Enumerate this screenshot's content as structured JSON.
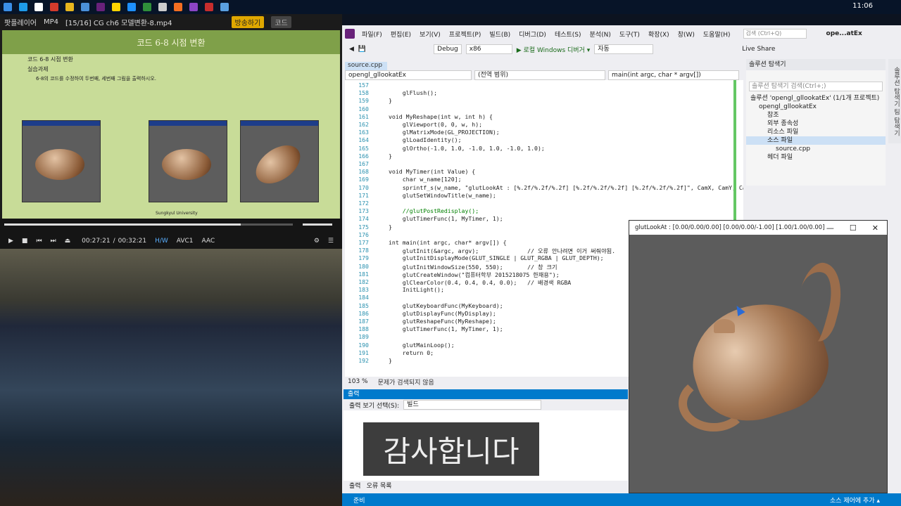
{
  "taskbar": {
    "clock": "11:06"
  },
  "player": {
    "app_name": "팟플레이어",
    "format": "MP4",
    "file_title": "[15/16] CG ch6 모델변환-8.mp4",
    "broadcast_btn": "방송하기",
    "code_btn": "코드",
    "time_current": "00:27:21",
    "time_total": "00:32:21",
    "hw": "H/W",
    "vcodec": "AVC1",
    "acodec": "AAC",
    "progress": 0.82
  },
  "slide": {
    "title": "코드 6-8 시점 변환",
    "bullet1": "코드 6-8 시점 변환",
    "bullet2": "실습과제",
    "bullet3": "6-8의 코드를 수정하여 두번째, 세번째 그림을 출력하시오.",
    "footer": "Sungkyul University"
  },
  "vs": {
    "menu": [
      "파일(F)",
      "편집(E)",
      "보기(V)",
      "프로젝트(P)",
      "빌드(B)",
      "디버그(D)",
      "테스트(S)",
      "분석(N)",
      "도구(T)",
      "확장(X)",
      "창(W)",
      "도움말(H)"
    ],
    "search_placeholder": "검색 (Ctrl+Q)",
    "window_title": "ope...atEx",
    "config": "Debug",
    "platform": "x86",
    "run_label": "▶ 로컬 Windows 디버거 ▾",
    "auto": "자동",
    "live_share": "Live Share",
    "doc_tab": "source.cpp",
    "nav_project": "opengl_gllookatEx",
    "nav_scope": "(전역 범위)",
    "nav_func": "main(int argc, char * argv[])",
    "zoom": "103 %",
    "issues": "문제가 검색되지 않음",
    "output_title": "출력",
    "output_select_label": "출력 보기 선택(S):",
    "output_select_value": "빌드",
    "output_tab1": "출력",
    "output_tab2": "오류 목록",
    "status_ready": "준비",
    "status_source_control": "소스 제어에 추가 ▴",
    "thanks": "감사합니다",
    "solution": {
      "header": "솔루션 탐색기",
      "search": "솔루션 탐색기 검색(Ctrl+;)",
      "side_tab": "솔루션 탐색기 팀 탐색기",
      "nodes": [
        {
          "text": "솔루션 'opengl_gllookatEx' (1/1개 프로젝트)",
          "indent": 0
        },
        {
          "text": "opengl_gllookatEx",
          "indent": 1
        },
        {
          "text": "참조",
          "indent": 2
        },
        {
          "text": "외부 종속성",
          "indent": 2
        },
        {
          "text": "리소스 파일",
          "indent": 2
        },
        {
          "text": "소스 파일",
          "indent": 2
        },
        {
          "text": "source.cpp",
          "indent": 3
        },
        {
          "text": "헤더 파일",
          "indent": 2
        }
      ]
    }
  },
  "code_lines": [
    {
      "n": "157",
      "t": ""
    },
    {
      "n": "158",
      "t": "    glFlush();"
    },
    {
      "n": "159",
      "t": "}"
    },
    {
      "n": "160",
      "t": ""
    },
    {
      "n": "161",
      "t": "void MyReshape(int w, int h) {"
    },
    {
      "n": "162",
      "t": "    glViewport(0, 0, w, h);"
    },
    {
      "n": "163",
      "t": "    glMatrixMode(GL_PROJECTION);"
    },
    {
      "n": "164",
      "t": "    glLoadIdentity();"
    },
    {
      "n": "165",
      "t": "    glOrtho(-1.0, 1.0, -1.0, 1.0, -1.0, 1.0);"
    },
    {
      "n": "166",
      "t": "}"
    },
    {
      "n": "167",
      "t": ""
    },
    {
      "n": "168",
      "t": "void MyTimer(int Value) {"
    },
    {
      "n": "169",
      "t": "    char w_name[120];"
    },
    {
      "n": "170",
      "t": "    sprintf_s(w_name, \"glutLookAt : [%.2f/%.2f/%.2f] [%.2f/%.2f/%.2f] [%.2f/%.2f/%.2f]\", CamX, CamY, CamZ, Vie"
    },
    {
      "n": "171",
      "t": "    glutSetWindowTitle(w_name);"
    },
    {
      "n": "172",
      "t": ""
    },
    {
      "n": "173",
      "t": "    //glutPostRedisplay();"
    },
    {
      "n": "174",
      "t": "    glutTimerFunc(1, MyTimer, 1);"
    },
    {
      "n": "175",
      "t": "}"
    },
    {
      "n": "176",
      "t": ""
    },
    {
      "n": "177",
      "t": "int main(int argc, char* argv[]) {"
    },
    {
      "n": "178",
      "t": "    glutInit(&argc, argv);              // 오류 안나려면 이거 써줘야됨."
    },
    {
      "n": "179",
      "t": "    glutInitDisplayMode(GLUT_SINGLE | GLUT_RGBA | GLUT_DEPTH);"
    },
    {
      "n": "180",
      "t": "    glutInitWindowSize(550, 550);       // 창 크기"
    },
    {
      "n": "181",
      "t": "    glutCreateWindow(\"컴퓨터학부 2015218075 한재용\");"
    },
    {
      "n": "182",
      "t": "    glClearColor(0.4, 0.4, 0.4, 0.0);   // 배경색 RGBA"
    },
    {
      "n": "183",
      "t": "    InitLight();"
    },
    {
      "n": "184",
      "t": ""
    },
    {
      "n": "185",
      "t": "    glutKeyboardFunc(MyKeyboard);"
    },
    {
      "n": "186",
      "t": "    glutDisplayFunc(MyDisplay);"
    },
    {
      "n": "187",
      "t": "    glutReshapeFunc(MyReshape);"
    },
    {
      "n": "188",
      "t": "    glutTimerFunc(1, MyTimer, 1);"
    },
    {
      "n": "189",
      "t": ""
    },
    {
      "n": "190",
      "t": "    glutMainLoop();"
    },
    {
      "n": "191",
      "t": "    return 0;"
    },
    {
      "n": "192",
      "t": "}"
    }
  ],
  "glut": {
    "title": "glutLookAt : [0.00/0.00/0.00] [0.00/0.00/-1.00] [1.00/1.00/0.00]"
  }
}
